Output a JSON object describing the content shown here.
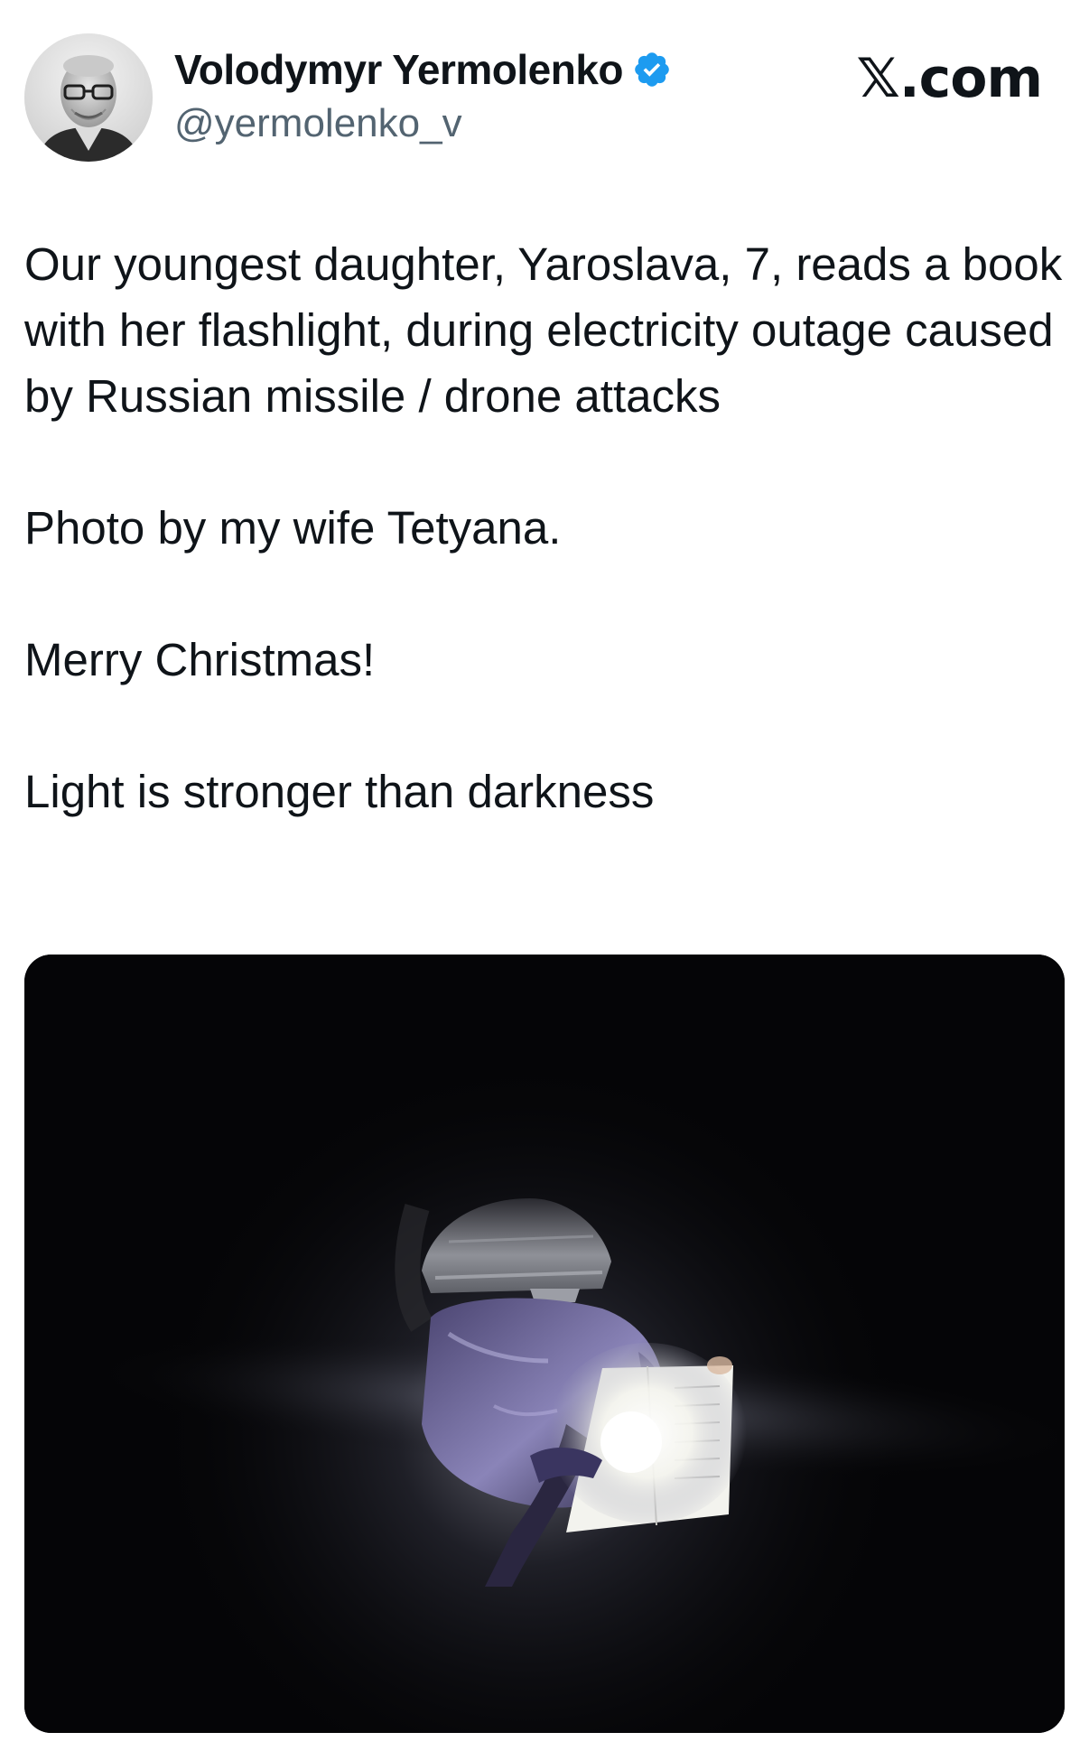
{
  "author": {
    "display_name": "Volodymyr Yermolenko",
    "handle": "@yermolenko_v",
    "verified": true,
    "avatar_icon": "profile-photo"
  },
  "brand": {
    "label": "𝕏.com"
  },
  "tweet": {
    "paragraphs": [
      "Our youngest daughter, Yaroslava, 7, reads a book with her flashlight, during electricity outage caused by Russian missile / drone attacks",
      "Photo by my wife Tetyana.",
      "Merry Christmas!",
      "Light is stronger than darkness"
    ]
  },
  "colors": {
    "text": "#0f1419",
    "handle": "#536471",
    "verified_badge": "#1d9bf0",
    "media_background": "#050507"
  }
}
